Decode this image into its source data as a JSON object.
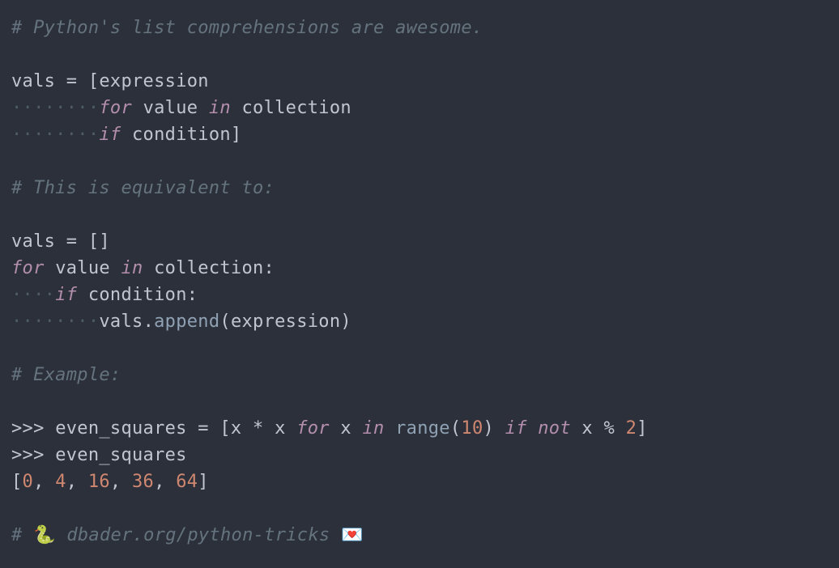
{
  "lines": {
    "l0_comment": "# Python's list comprehensions are awesome.",
    "l2_vals": "vals",
    "l2_eq": " = ",
    "l2_lb": "[",
    "l2_expr": "expression",
    "l3_ws": "········",
    "l3_for": "for",
    "l3_sp1": " ",
    "l3_value": "value",
    "l3_sp2": " ",
    "l3_in": "in",
    "l3_sp3": " ",
    "l3_coll": "collection",
    "l4_ws": "········",
    "l4_if": "if",
    "l4_sp": " ",
    "l4_cond": "condition",
    "l4_rb": "]",
    "l6_comment": "# This is equivalent to:",
    "l8_vals": "vals",
    "l8_eq": " = ",
    "l8_lb": "[",
    "l8_rb": "]",
    "l9_for": "for",
    "l9_sp1": " ",
    "l9_value": "value",
    "l9_sp2": " ",
    "l9_in": "in",
    "l9_sp3": " ",
    "l9_coll": "collection:",
    "l10_ws": "····",
    "l10_if": "if",
    "l10_sp": " ",
    "l10_cond": "condition:",
    "l11_ws": "········",
    "l11_vals": "vals",
    "l11_dot": ".",
    "l11_append": "append",
    "l11_lp": "(",
    "l11_expr": "expression",
    "l11_rp": ")",
    "l13_comment": "# Example:",
    "l15_prompt": ">>>",
    "l15_sp0": " ",
    "l15_es": "even_squares",
    "l15_eq": " = ",
    "l15_lb": "[",
    "l15_x1": "x",
    "l15_mul": " * ",
    "l15_x2": "x",
    "l15_sp1": " ",
    "l15_for": "for",
    "l15_sp2": " ",
    "l15_x3": "x",
    "l15_sp3": " ",
    "l15_in": "in",
    "l15_sp4": " ",
    "l15_range": "range",
    "l15_lp": "(",
    "l15_10": "10",
    "l15_rp": ")",
    "l15_sp5": " ",
    "l15_if": "if",
    "l15_sp6": " ",
    "l15_not": "not",
    "l15_sp7": " ",
    "l15_x4": "x",
    "l15_mod": " % ",
    "l15_2": "2",
    "l15_rb": "]",
    "l16_prompt": ">>>",
    "l16_sp": " ",
    "l16_es": "even_squares",
    "l17_lb": "[",
    "l17_n0": "0",
    "l17_c1": ", ",
    "l17_n1": "4",
    "l17_c2": ", ",
    "l17_n2": "16",
    "l17_c3": ", ",
    "l17_n3": "36",
    "l17_c4": ", ",
    "l17_n4": "64",
    "l17_rb": "]",
    "l19_hash": "# ",
    "l19_snake": "🐍",
    "l19_sp1": " ",
    "l19_url": "dbader.org/python-tricks",
    "l19_sp2": " ",
    "l19_mail": "💌"
  }
}
